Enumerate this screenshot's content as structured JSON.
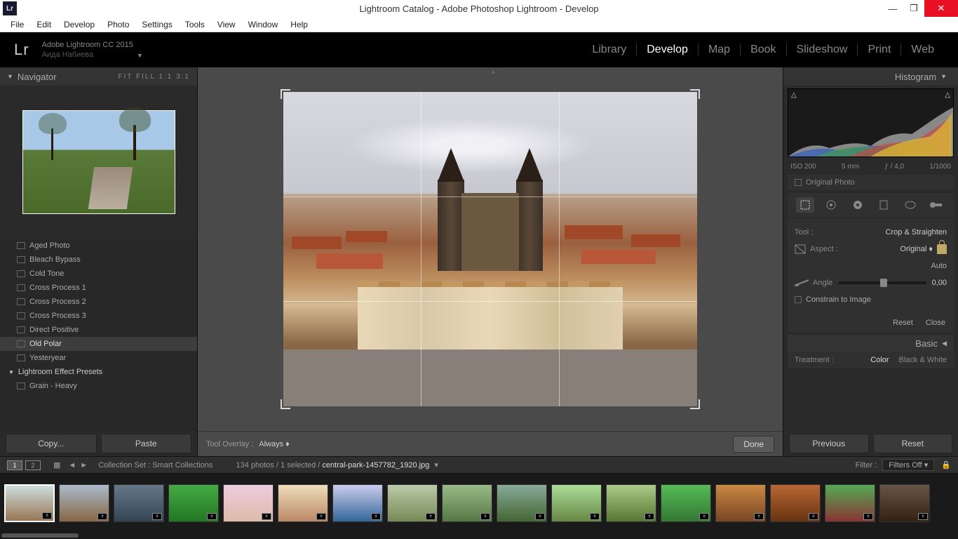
{
  "window": {
    "title": "Lightroom Catalog - Adobe Photoshop Lightroom - Develop"
  },
  "menu": [
    "File",
    "Edit",
    "Develop",
    "Photo",
    "Settings",
    "Tools",
    "View",
    "Window",
    "Help"
  ],
  "identity": {
    "line1": "Adobe Lightroom CC 2015",
    "line2": "Аида Набиева"
  },
  "modules": {
    "items": [
      "Library",
      "Develop",
      "Map",
      "Book",
      "Slideshow",
      "Print",
      "Web"
    ],
    "active": "Develop"
  },
  "navigator": {
    "title": "Navigator",
    "zoom": "FIT   FILL   1:1   3:1"
  },
  "presets": {
    "items": [
      "Aged Photo",
      "Bleach Bypass",
      "Cold Tone",
      "Cross Process 1",
      "Cross Process 2",
      "Cross Process 3",
      "Direct Positive",
      "Old Polar",
      "Yesteryear"
    ],
    "selected": "Old Polar",
    "group": "Lightroom Effect Presets",
    "subitem": "Grain - Heavy"
  },
  "left_buttons": {
    "copy": "Copy...",
    "paste": "Paste"
  },
  "center": {
    "tool_overlay_label": "Tool Overlay :",
    "tool_overlay_value": "Always ",
    "done": "Done"
  },
  "histogram": {
    "title": "Histogram",
    "iso": "ISO 200",
    "focal": "5 mm",
    "aperture": "ƒ / 4,0",
    "shutter": "1/1000",
    "original_photo": "Original Photo"
  },
  "tool_panel": {
    "tool_label": "Tool :",
    "tool_name": "Crop & Straighten",
    "aspect_label": "Aspect :",
    "aspect_value": "Original ",
    "auto": "Auto",
    "angle_label": "Angle",
    "angle_value": "0,00",
    "constrain": "Constrain to Image",
    "reset": "Reset",
    "close": "Close"
  },
  "basic": {
    "title": "Basic",
    "treatment_label": "Treatment :",
    "color": "Color",
    "bw": "Black & White"
  },
  "right_buttons": {
    "previous": "Previous",
    "reset": "Reset"
  },
  "filmstrip_bar": {
    "screen1": "1",
    "screen2": "2",
    "collection": "Collection Set : Smart Collections",
    "count": "134 photos / 1 selected /",
    "filename": "central-park-1457782_1920.jpg",
    "filter_label": "Filter :",
    "filter_value": "Filters Off"
  }
}
